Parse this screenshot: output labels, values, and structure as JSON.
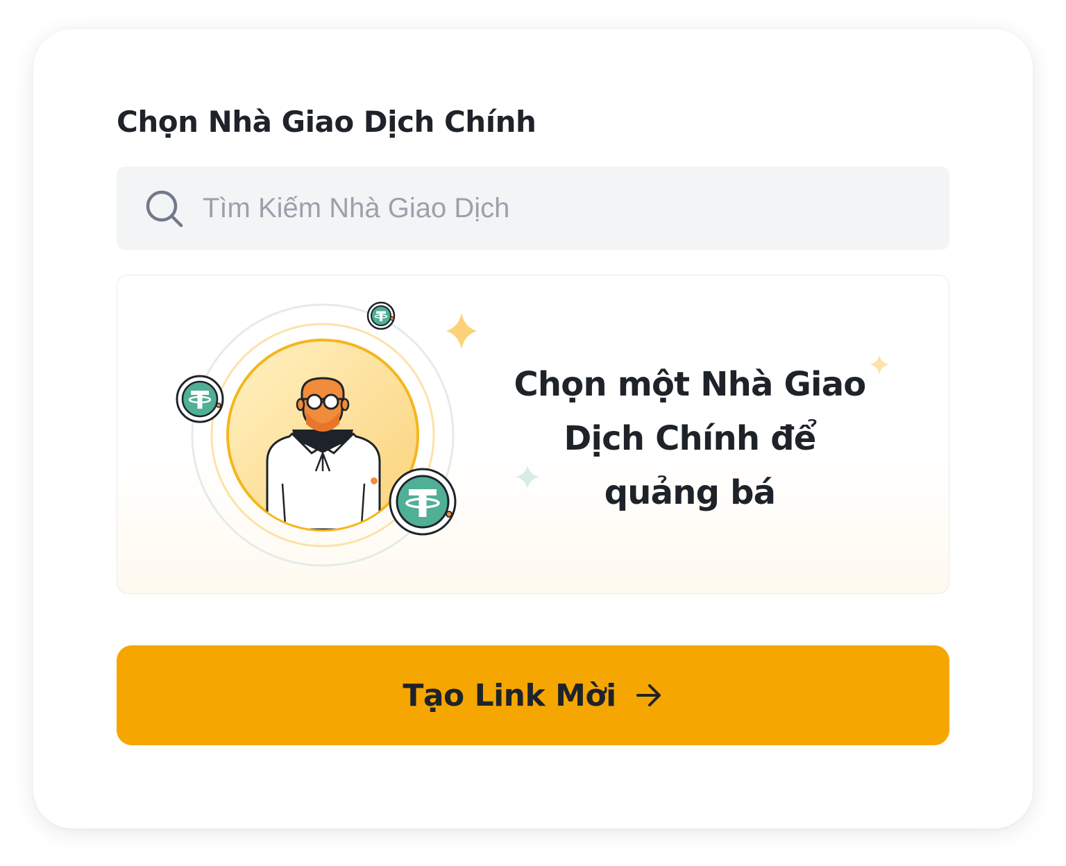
{
  "section": {
    "title": "Chọn Nhà Giao Dịch Chính"
  },
  "search": {
    "placeholder": "Tìm Kiếm Nhà Giao Dịch",
    "value": "",
    "icon": "search-icon"
  },
  "empty_state": {
    "message": "Chọn một Nhà Giao Dịch Chính để quảng bá",
    "illustration": "trader-avatar-with-usdt-coins",
    "coin_icon": "usdt-coin-icon"
  },
  "cta": {
    "label": "Tạo Link Mời",
    "icon": "arrow-right-icon"
  },
  "colors": {
    "accent": "#f6a600",
    "text_primary": "#1e2329",
    "placeholder": "#9ba1ab",
    "search_bg": "#f3f4f6",
    "coin_green": "#50af95"
  }
}
